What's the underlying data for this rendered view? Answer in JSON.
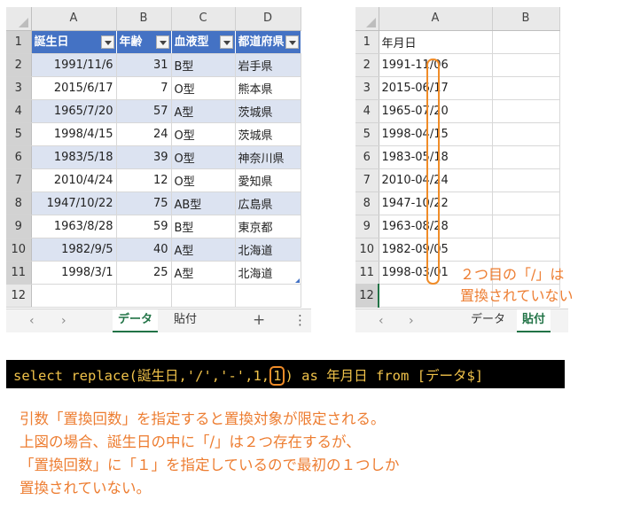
{
  "left_sheet": {
    "columns": [
      "A",
      "B",
      "C",
      "D"
    ],
    "row_numbers": [
      "1",
      "2",
      "3",
      "4",
      "5",
      "6",
      "7",
      "8",
      "9",
      "10",
      "11",
      "12"
    ],
    "header": [
      "誕生日",
      "年齢",
      "血液型",
      "都道府県"
    ],
    "rows": [
      [
        "1991/11/6",
        "31",
        "B型",
        "岩手県"
      ],
      [
        "2015/6/17",
        "7",
        "O型",
        "熊本県"
      ],
      [
        "1965/7/20",
        "57",
        "A型",
        "茨城県"
      ],
      [
        "1998/4/15",
        "24",
        "O型",
        "茨城県"
      ],
      [
        "1983/5/18",
        "39",
        "O型",
        "神奈川県"
      ],
      [
        "2010/4/24",
        "12",
        "O型",
        "愛知県"
      ],
      [
        "1947/10/22",
        "75",
        "AB型",
        "広島県"
      ],
      [
        "1963/8/28",
        "59",
        "B型",
        "東京都"
      ],
      [
        "1982/9/5",
        "40",
        "A型",
        "北海道"
      ],
      [
        "1998/3/1",
        "25",
        "A型",
        "北海道"
      ]
    ],
    "tabs": [
      "データ",
      "貼付"
    ],
    "active_tab": "データ",
    "nav_prev": "‹",
    "nav_next": "›",
    "add_sheet": "+",
    "more": "⋮"
  },
  "right_sheet": {
    "columns": [
      "A",
      "B"
    ],
    "row_numbers": [
      "1",
      "2",
      "3",
      "4",
      "5",
      "6",
      "7",
      "8",
      "9",
      "10",
      "11",
      "12"
    ],
    "header": "年月日",
    "values": [
      "1991-11/06",
      "2015-06/17",
      "1965-07/20",
      "1998-04/15",
      "1983-05/18",
      "2010-04/24",
      "1947-10/22",
      "1963-08/28",
      "1982-09/05",
      "1998-03/01"
    ],
    "tabs": [
      "データ",
      "貼付"
    ],
    "active_tab": "貼付",
    "nav_prev": "‹",
    "nav_next": "›",
    "annotation_line1": "２つ目の「/」は",
    "annotation_line2": "置換されていない"
  },
  "sql": {
    "before": "select replace(誕生日,'/','-',1,",
    "highlight": "1",
    "after": ") as 年月日 from [データ$]"
  },
  "explanation": [
    "引数「置換回数」を指定すると置換対象が限定される。",
    "上図の場合、誕生日の中に「/」は２つ存在するが、",
    "「置換回数」に「１」を指定しているので最初の１つしか",
    "置換されていない。"
  ],
  "colors": {
    "table_header": "#4472c4",
    "band": "#dce3f1",
    "annotation": "#ed7d31",
    "sql_text": "#f0c24a",
    "sql_bg": "#000000",
    "active_tab": "#217346"
  }
}
